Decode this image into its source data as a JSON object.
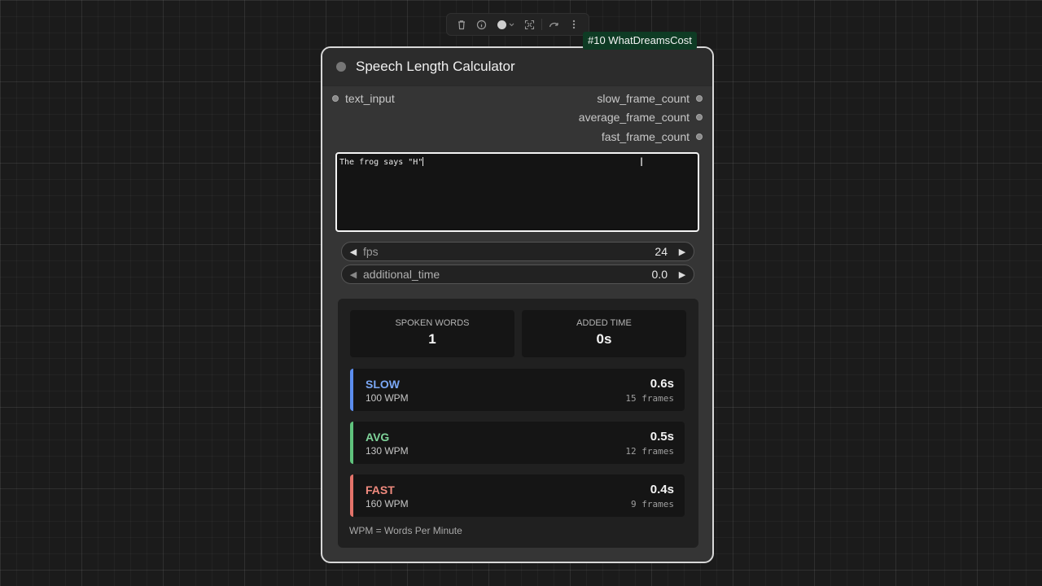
{
  "toolbar": {
    "icons": [
      "trash-icon",
      "info-icon",
      "color-dot-icon",
      "fit-view-icon",
      "bypass-icon",
      "more-icon"
    ]
  },
  "badge": {
    "label": "#10 WhatDreamsCost"
  },
  "node": {
    "title": "Speech Length Calculator",
    "inputs": [
      {
        "label": "text_input"
      }
    ],
    "outputs": [
      {
        "label": "slow_frame_count"
      },
      {
        "label": "average_frame_count"
      },
      {
        "label": "fast_frame_count"
      }
    ],
    "text_value": "The frog says \"H\"",
    "widgets": {
      "fps": {
        "label": "fps",
        "value": "24"
      },
      "additional_time": {
        "label": "additional_time",
        "value": "0.0"
      }
    },
    "stats": {
      "spoken_words": {
        "label": "SPOKEN WORDS",
        "value": "1"
      },
      "added_time": {
        "label": "ADDED TIME",
        "value": "0s"
      }
    },
    "speeds": [
      {
        "name": "SLOW",
        "wpm": "100 WPM",
        "time": "0.6s",
        "frames": "15 frames",
        "color": "#7aa7f5"
      },
      {
        "name": "AVG",
        "wpm": "130 WPM",
        "time": "0.5s",
        "frames": "12 frames",
        "color": "#7fd49a"
      },
      {
        "name": "FAST",
        "wpm": "160 WPM",
        "time": "0.4s",
        "frames": "9 frames",
        "color": "#f08a7e"
      }
    ],
    "footnote": "WPM = Words Per Minute"
  },
  "colors": {
    "badge_bg": "#0e3b24",
    "slow_accent": "#5b8def",
    "avg_accent": "#5fc27c",
    "fast_accent": "#e4736a"
  }
}
